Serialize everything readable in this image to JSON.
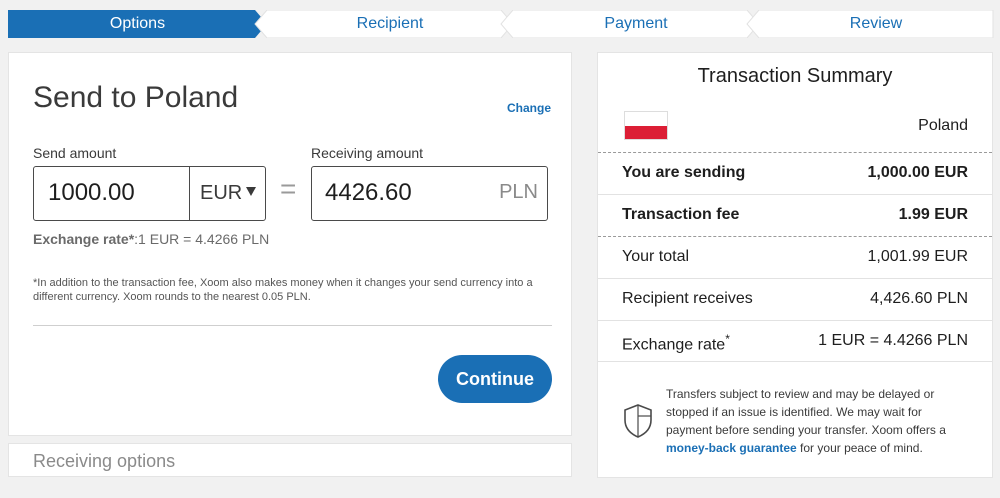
{
  "stepper": {
    "steps": [
      "Options",
      "Recipient",
      "Payment",
      "Review"
    ],
    "active_color": "#1a6fb5"
  },
  "send_form": {
    "title": "Send to Poland",
    "change_link": "Change",
    "send_label": "Send amount",
    "send_value": "1000.00",
    "send_currency": "EUR",
    "equals": "=",
    "receive_label": "Receiving amount",
    "receive_value": "4426.60",
    "receive_currency": "PLN",
    "rate_label": "Exchange rate",
    "rate_mark": "*",
    "rate_value": ":1 EUR = 4.4266 PLN",
    "note": "*In addition to the transaction fee, Xoom also makes money when it changes your send currency into a different currency. Xoom rounds to the nearest 0.05 PLN.",
    "continue_label": "Continue"
  },
  "receiving": {
    "label": "Receiving options"
  },
  "summary": {
    "title": "Transaction Summary",
    "country": "Poland",
    "flag_colors": [
      "#ffffff",
      "#dc1e35"
    ],
    "rows": [
      {
        "label": "You are sending",
        "value": "1,000.00 EUR"
      },
      {
        "label": "Transaction fee",
        "value": "1.99 EUR"
      },
      {
        "label": "Your total",
        "value": "1,001.99  EUR"
      },
      {
        "label": "Recipient receives",
        "value": "4,426.60 PLN"
      },
      {
        "label": "Exchange rate",
        "mark": "*",
        "value": "1 EUR = 4.4266 PLN"
      }
    ],
    "disclaimer_before": "Transfers subject to review and may be delayed or stopped if an issue is identified. We may wait for payment before sending your transfer. Xoom offers a ",
    "disclaimer_link": "money-back guarantee",
    "disclaimer_after": " for your peace of mind."
  }
}
